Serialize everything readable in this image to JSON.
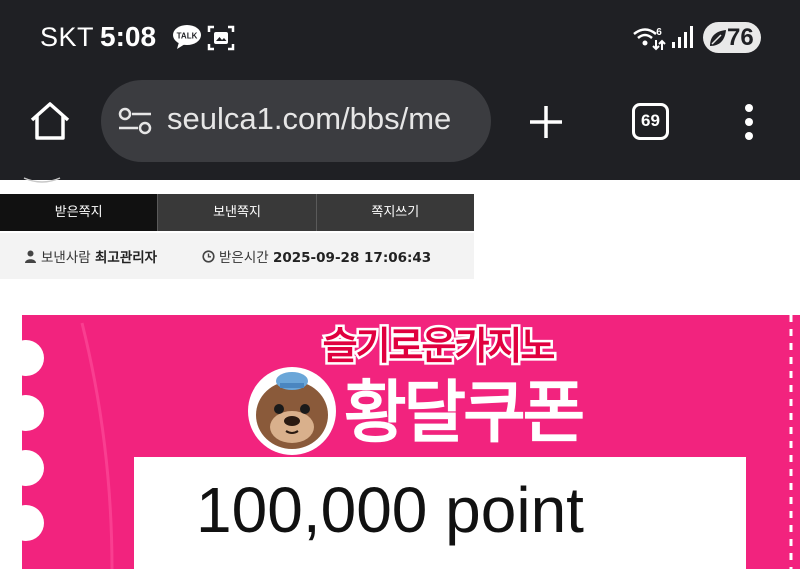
{
  "status_bar": {
    "carrier": "SKT",
    "time": "5:08",
    "battery": "76"
  },
  "browser": {
    "url": "seulca1.com/bbs/me",
    "tab_count": "69"
  },
  "message_tabs": [
    {
      "label": "받은쪽지"
    },
    {
      "label": "보낸쪽지"
    },
    {
      "label": "쪽지쓰기"
    }
  ],
  "message_meta": {
    "sender_label": "보낸사람",
    "sender": "최고관리자",
    "time_label": "받은시간",
    "time": "2025-09-28 17:06:43"
  },
  "coupon": {
    "brand": "슬기로운카지노",
    "title": "황달쿠폰",
    "amount": "100,000 point",
    "colors": {
      "background": "#f2237e",
      "brand_text": "#e0003f"
    }
  }
}
